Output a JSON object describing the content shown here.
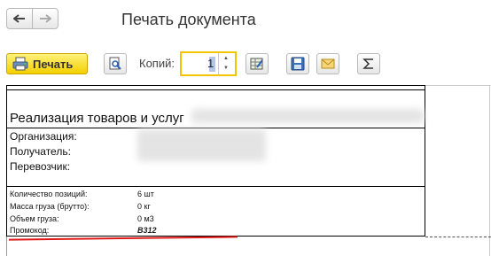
{
  "header": {
    "title": "Печать документа"
  },
  "toolbar": {
    "print_label": "Печать",
    "copies_label": "Копий:",
    "copies_value": "1"
  },
  "document": {
    "title": "Реализация товаров и услуг",
    "fields": {
      "org_label": "Организация:",
      "recipient_label": "Получатель:",
      "carrier_label": "Перевозчик:"
    },
    "summary": [
      {
        "label": "Количество позиций:",
        "value": "6 шт"
      },
      {
        "label": "Масса груза (брутто):",
        "value": "0 кг"
      },
      {
        "label": "Объем груза:",
        "value": "0 м3"
      }
    ],
    "promo": {
      "label": "Промокод:",
      "value": "В312"
    }
  },
  "colors": {
    "accent_yellow": "#f3d000",
    "underline_red": "#e01818"
  },
  "icons": [
    "arrow-left-icon",
    "arrow-right-icon",
    "printer-icon",
    "preview-icon",
    "table-edit-icon",
    "save-icon",
    "envelope-icon",
    "sigma-icon"
  ]
}
